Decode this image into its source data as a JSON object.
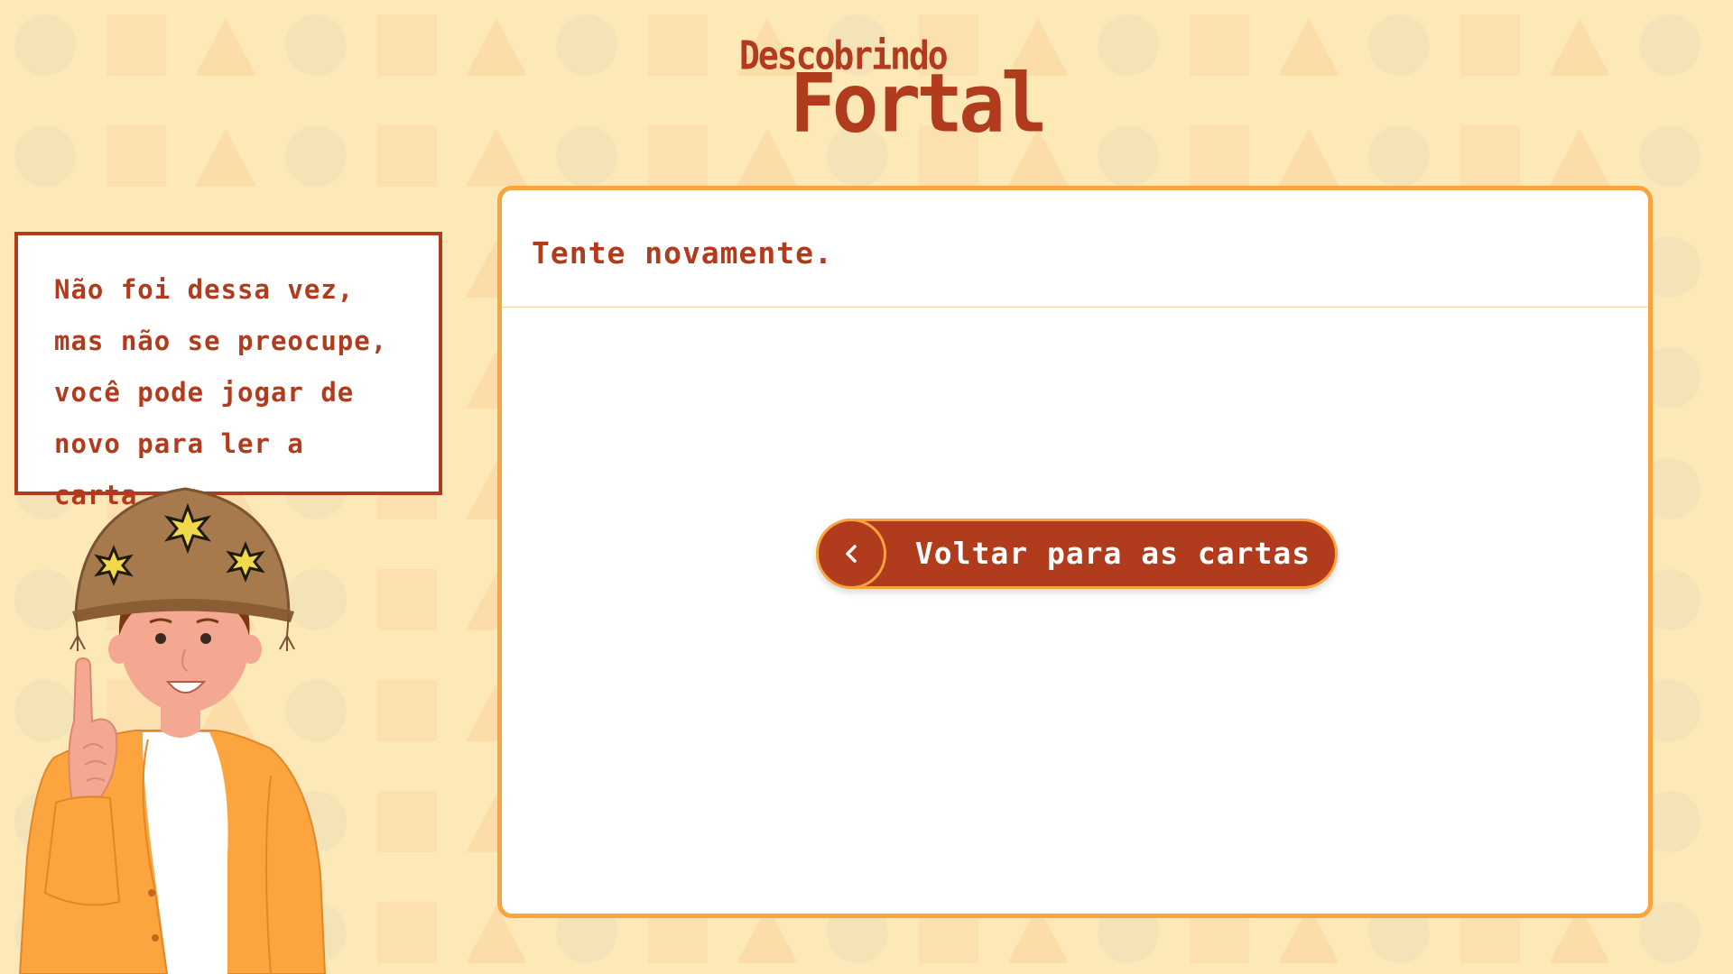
{
  "app": {
    "logo_small": "Descobrindo",
    "logo_big": "Fortal"
  },
  "speech": {
    "text": "Não foi dessa vez, mas não se preocupe, você pode jogar de novo para ler a carta."
  },
  "card": {
    "title": "Tente novamente.",
    "button_label": "Voltar para as cartas",
    "button_icon": "chevron-left-icon"
  },
  "colors": {
    "background": "#fde9b8",
    "brand": "#b13b1d",
    "accent": "#f9a43c",
    "card": "#ffffff"
  }
}
